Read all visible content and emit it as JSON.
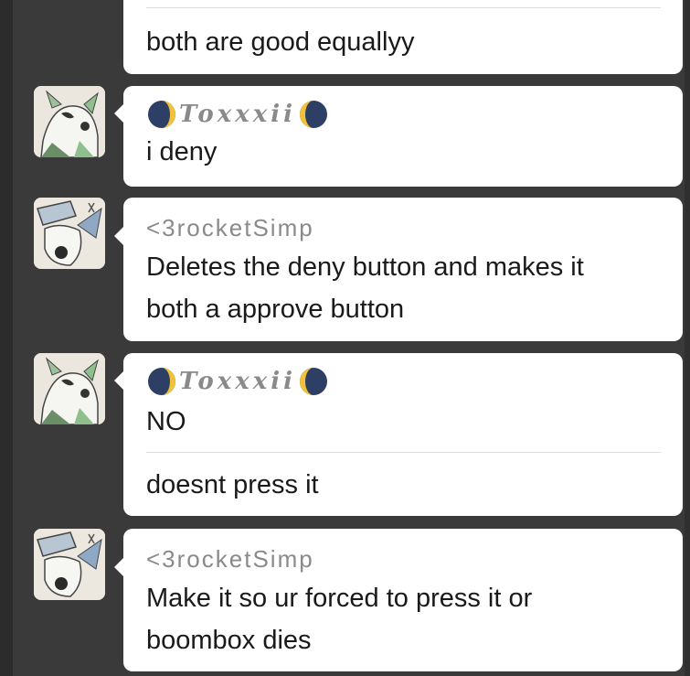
{
  "messages": [
    {
      "type": "continuation",
      "text": "both are good equallyy"
    },
    {
      "sender": "Toxxxii",
      "lines": [
        "i deny"
      ]
    },
    {
      "sender": "<3rocketSimp",
      "lines": [
        "Deletes the deny button and makes it",
        "both a approve button"
      ]
    },
    {
      "sender": "Toxxxii",
      "lines": [
        "NO"
      ],
      "followup": "doesnt press it"
    },
    {
      "sender": "<3rocketSimp",
      "lines": [
        "Make it so ur forced to press it or",
        "boombox dies"
      ]
    }
  ]
}
